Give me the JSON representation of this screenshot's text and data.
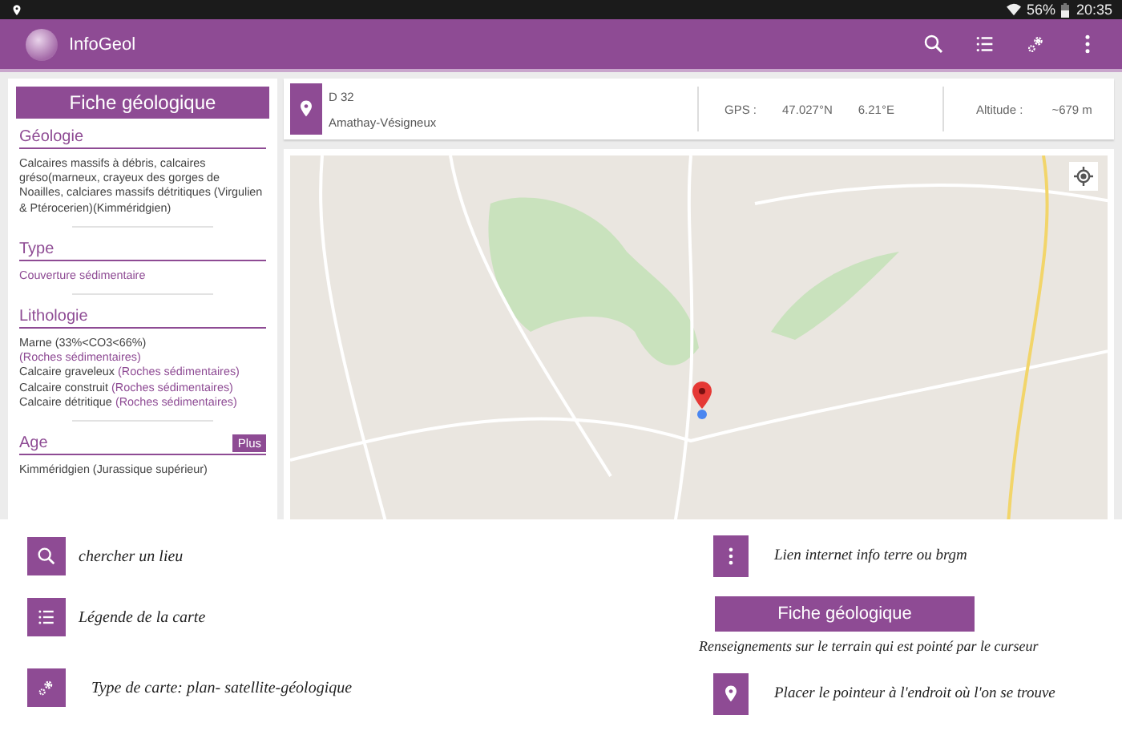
{
  "status_bar": {
    "battery": "56%",
    "time": "20:35"
  },
  "app_bar": {
    "title": "InfoGeol"
  },
  "sheet": {
    "title": "Fiche géologique",
    "sections": [
      {
        "heading": "Géologie",
        "lines": [
          {
            "text": "Calcaires massifs à débris, calcaires gréso(marneux, crayeux des gorges de Noailles, calciares massifs détritiques (Virgulien & Ptérocerien)(Kimméridgien)"
          }
        ]
      },
      {
        "heading": "Type",
        "lines": [
          {
            "text": "Couverture sédimentaire",
            "accent": true
          }
        ]
      },
      {
        "heading": "Lithologie",
        "lines": [
          {
            "text": "Marne (33%<CO3<66%)",
            "link": "(Roches sédimentaires)"
          },
          {
            "text": "Calcaire graveleux",
            "link": "(Roches sédimentaires)"
          },
          {
            "text": "Calcaire construit",
            "link": "(Roches sédimentaires)"
          },
          {
            "text": "Calcaire détritique",
            "link": "(Roches sédimentaires)"
          }
        ]
      },
      {
        "heading": "Age",
        "button": "Plus",
        "lines": [
          {
            "text": "Kimméridgien (Jurassique supérieur)"
          }
        ]
      }
    ]
  },
  "location": {
    "road": "D 32",
    "place": "Amathay-Vésigneux",
    "gps_label": "GPS :",
    "latitude": "47.027°N",
    "longitude": "6.21°E",
    "altitude_label": "Altitude :",
    "altitude": "~679 m"
  },
  "legend_left": [
    {
      "kind": "search",
      "text": "chercher un lieu"
    },
    {
      "kind": "list",
      "text": "Légende de la carte"
    },
    {
      "kind": "gear",
      "text": "Type de carte: plan- satellite-géologique"
    }
  ],
  "legend_right": [
    {
      "kind": "more",
      "text": "Lien internet info terre ou brgm"
    },
    {
      "kind": "button",
      "label": "Fiche géologique",
      "text": "Renseignements sur le terrain qui est pointé par le curseur"
    },
    {
      "kind": "pin",
      "text": "Placer le pointeur à l'endroit où l'on se trouve"
    }
  ]
}
